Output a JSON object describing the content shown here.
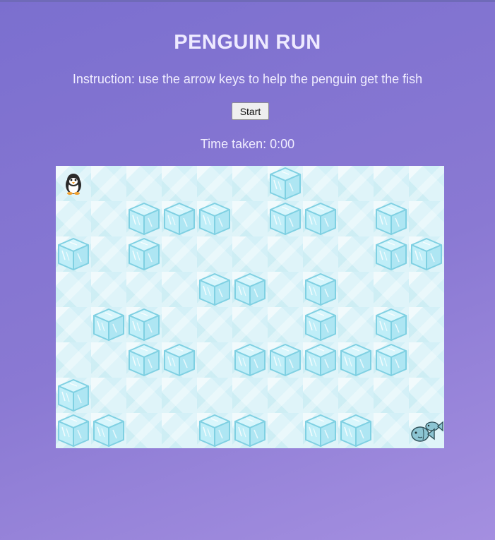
{
  "game": {
    "title": "PENGUIN RUN",
    "instruction": "Instruction: use the arrow keys to help the penguin get the fish",
    "start_label": "Start",
    "timer_label": "Time taken: 0:00"
  },
  "grid": {
    "cols": 11,
    "rows": 8,
    "penguin": [
      0,
      0
    ],
    "fish": [
      10,
      7
    ],
    "ice_blocks": [
      [
        6,
        0
      ],
      [
        2,
        1
      ],
      [
        3,
        1
      ],
      [
        4,
        1
      ],
      [
        6,
        1
      ],
      [
        7,
        1
      ],
      [
        9,
        1
      ],
      [
        0,
        2
      ],
      [
        2,
        2
      ],
      [
        9,
        2
      ],
      [
        10,
        2
      ],
      [
        4,
        3
      ],
      [
        5,
        3
      ],
      [
        7,
        3
      ],
      [
        1,
        4
      ],
      [
        2,
        4
      ],
      [
        7,
        4
      ],
      [
        9,
        4
      ],
      [
        2,
        5
      ],
      [
        3,
        5
      ],
      [
        5,
        5
      ],
      [
        6,
        5
      ],
      [
        7,
        5
      ],
      [
        8,
        5
      ],
      [
        9,
        5
      ],
      [
        0,
        6
      ],
      [
        0,
        7
      ],
      [
        1,
        7
      ],
      [
        4,
        7
      ],
      [
        5,
        7
      ],
      [
        7,
        7
      ],
      [
        8,
        7
      ]
    ]
  },
  "colors": {
    "ice_face": "#bfeef8",
    "ice_edge": "#7fd0e2",
    "fish": "#8cc5d3"
  },
  "icons": {
    "penguin": "penguin-icon",
    "fish": "fish-icon",
    "ice": "ice-block-icon"
  }
}
